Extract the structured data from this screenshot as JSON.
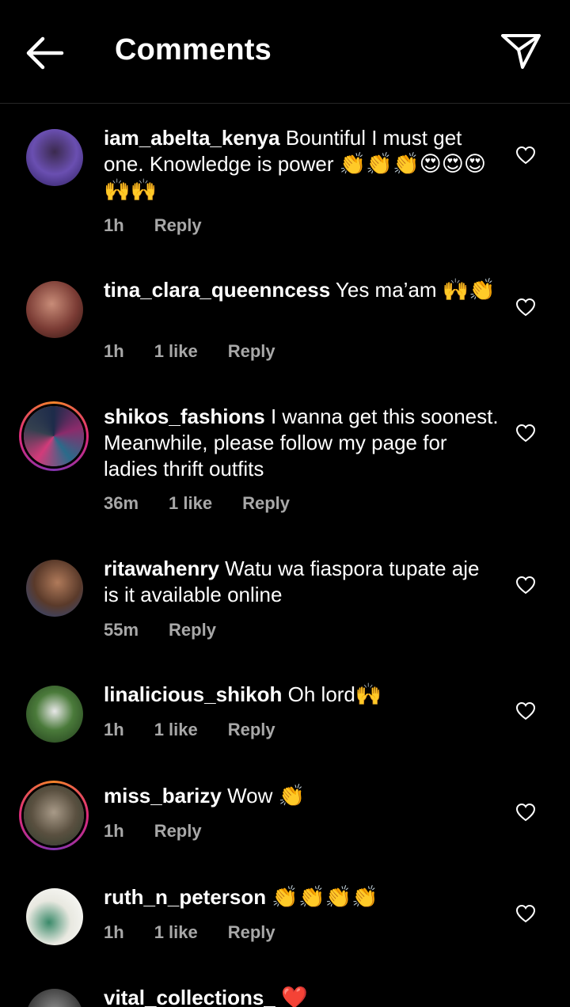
{
  "header": {
    "title": "Comments",
    "back_icon": "arrow-left-icon",
    "send_icon": "paper-plane-icon"
  },
  "colors": {
    "background": "#000000",
    "text": "#ffffff",
    "meta": "#a8a8a8",
    "divider": "#262626"
  },
  "comments": [
    {
      "username": "iam_abelta_kenya",
      "text": " Bountiful I must get one. Knowledge is power ",
      "emojis": "👏👏👏😍😍😍🙌🙌",
      "time": "1h",
      "likes": "",
      "reply": "Reply"
    },
    {
      "username": "tina_clara_queenncess",
      "text": " Yes ma’am ",
      "emojis": "🙌👏",
      "time": "1h",
      "likes": "1 like",
      "reply": "Reply"
    },
    {
      "username": "shikos_fashions",
      "text": " I wanna get this soonest. Meanwhile, please follow my page for ladies thrift outfits",
      "emojis": "",
      "time": "36m",
      "likes": "1 like",
      "reply": "Reply"
    },
    {
      "username": "ritawahenry",
      "text": " Watu wa fiaspora tupate aje is it available online",
      "emojis": "",
      "time": "55m",
      "likes": "",
      "reply": "Reply"
    },
    {
      "username": "linalicious_shikoh",
      "text": " Oh lord",
      "emojis": "🙌",
      "time": "1h",
      "likes": "1 like",
      "reply": "Reply"
    },
    {
      "username": "miss_barizy",
      "text": " Wow ",
      "emojis": "👏",
      "time": "1h",
      "likes": "",
      "reply": "Reply"
    },
    {
      "username": "ruth_n_peterson",
      "text": " ",
      "emojis": "👏👏👏👏",
      "time": "1h",
      "likes": "1 like",
      "reply": "Reply"
    },
    {
      "username": "vital_collections_",
      "text": " ",
      "emojis": "❤️",
      "time": "",
      "likes": "",
      "reply": ""
    }
  ]
}
